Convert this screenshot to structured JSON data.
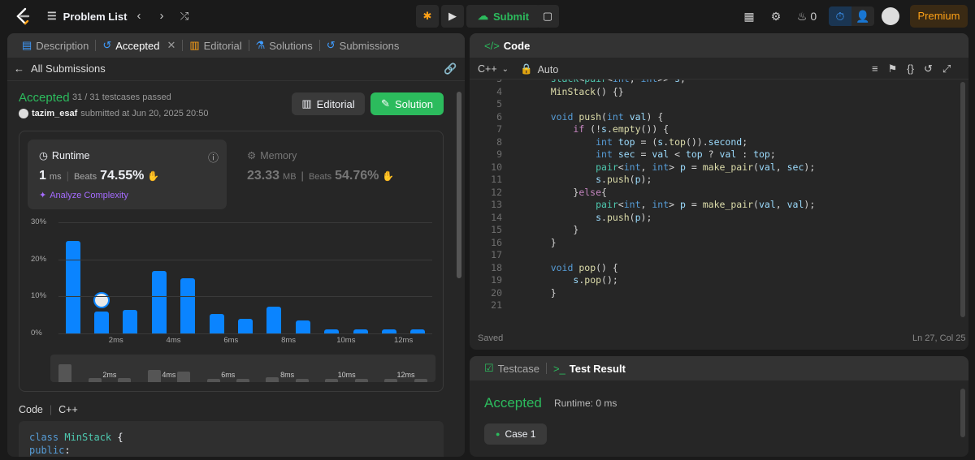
{
  "topbar": {
    "problem_list": "Problem List",
    "submit": "Submit",
    "streak": "0",
    "premium": "Premium"
  },
  "left": {
    "tabs": [
      "Description",
      "Accepted",
      "Editorial",
      "Solutions",
      "Submissions"
    ],
    "all_submissions": "All Submissions",
    "status": "Accepted",
    "testcases": "31 / 31 testcases passed",
    "user": "tazim_esaf",
    "submitted": "submitted at Jun 20, 2025 20:50",
    "editorial_btn": "Editorial",
    "solution_btn": "Solution",
    "runtime": {
      "label": "Runtime",
      "value": "1",
      "unit": "ms",
      "beats_label": "Beats",
      "beats": "74.55%",
      "analyze": "Analyze Complexity"
    },
    "memory": {
      "label": "Memory",
      "value": "23.33",
      "unit": "MB",
      "beats_label": "Beats",
      "beats": "54.76%"
    },
    "code_label": "Code",
    "code_lang": "C++",
    "code_lines": [
      "class MinStack {",
      "public:"
    ]
  },
  "chart_data": {
    "type": "bar",
    "yticks": [
      "30%",
      "20%",
      "10%",
      "0%"
    ],
    "ylim": [
      0,
      30
    ],
    "xticks": [
      "2ms",
      "4ms",
      "6ms",
      "8ms",
      "10ms",
      "12ms"
    ],
    "values": [
      25,
      6,
      6.3,
      16.8,
      15,
      5.2,
      4,
      7.3,
      3.6,
      1.2,
      1,
      1.2,
      1
    ],
    "user_bar_index": 1
  },
  "editor": {
    "title": "Code",
    "lang": "C++",
    "auto": "Auto",
    "saved": "Saved",
    "cursor": "Ln 27, Col 25",
    "line_numbers": [
      "3",
      "4",
      "5",
      "6",
      "7",
      "8",
      "9",
      "10",
      "11",
      "12",
      "13",
      "14",
      "15",
      "16",
      "17",
      "18",
      "19",
      "20",
      "21"
    ]
  },
  "test": {
    "tab1": "Testcase",
    "tab2": "Test Result",
    "status": "Accepted",
    "runtime": "Runtime: 0 ms",
    "case": "Case 1"
  }
}
